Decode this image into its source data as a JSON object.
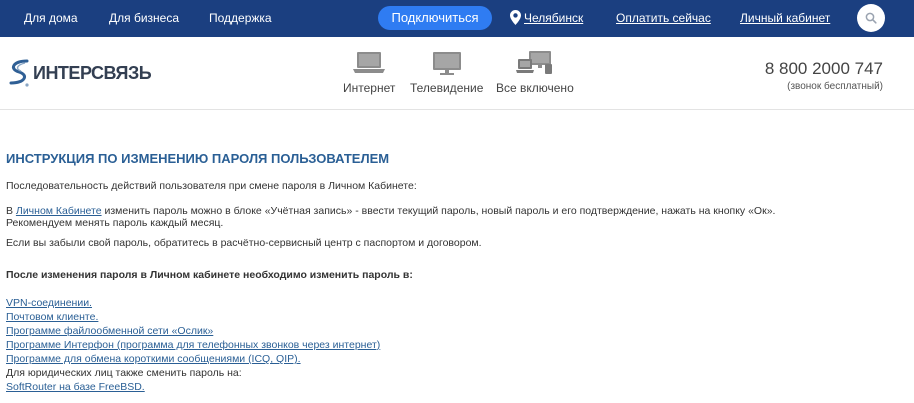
{
  "topnav": {
    "home": "Для дома",
    "business": "Для бизнеса",
    "support": "Поддержка",
    "connect": "Подключиться",
    "city": "Челябинск",
    "pay": "Оплатить сейчас",
    "cabinet": "Личный кабинет"
  },
  "header": {
    "logo": "ИНТЕРСВЯЗЬ",
    "services": [
      "Интернет",
      "Телевидение",
      "Все включено"
    ],
    "phone": "8 800 2000 747",
    "phone_note": "(звонок бесплатный)"
  },
  "content": {
    "title": "ИНСТРУКЦИЯ ПО ИЗМЕНЕНИЮ ПАРОЛЯ ПОЛЬЗОВАТЕЛЕМ",
    "intro": "Последовательность действий пользователя при смене пароля в Личном Кабинете:",
    "p2_prefix": "В ",
    "p2_link": "Личном Кабинете",
    "p2_rest": " изменить пароль можно в блоке «Учётная запись» - ввести текущий пароль, новый пароль и его подтверждение, нажать на кнопку «Ок».",
    "p2_line2": "Рекомендуем менять пароль каждый месяц.",
    "p3": "Если вы забыли свой пароль, обратитесь в расчётно-сервисный центр с паспортом и договором.",
    "bold": "После изменения пароля в Личном кабинете необходимо изменить пароль в:",
    "links": [
      "VPN-соединении.",
      "Почтовом клиенте.",
      " Программе файлообменной сети «Ослик»",
      "Программе Интерфон (программа для телефонных звонков через интернет)",
      "Программе для обмена короткими сообщениями (ICQ, QIP)."
    ],
    "legal": "Для юридических лиц также сменить пароль на:",
    "last_link": "SoftRouter на базе FreeBSD."
  },
  "colors": {
    "topbar": "#1b3f80",
    "connect_button": "#2f7cf2",
    "title": "#2a5f95",
    "link": "#2a5f95"
  }
}
